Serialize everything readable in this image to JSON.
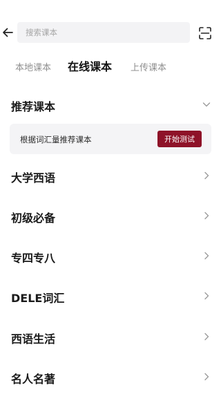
{
  "header": {
    "back_icon": "arrow-left-icon",
    "search_placeholder": "搜索课本",
    "search_value": "",
    "scan_icon": "scan-icon"
  },
  "tabs": [
    {
      "label": "本地课本",
      "active": false
    },
    {
      "label": "在线课本",
      "active": true
    },
    {
      "label": "上传课本",
      "active": false
    }
  ],
  "recommend": {
    "title": "推荐课本",
    "expanded": true,
    "hint": "根据词汇量推荐课本",
    "button_label": "开始测试"
  },
  "categories": [
    {
      "label": "大学西语"
    },
    {
      "label": "初级必备"
    },
    {
      "label": "专四专八"
    },
    {
      "label": "DELE词汇"
    },
    {
      "label": "西语生活"
    },
    {
      "label": "名人名著"
    }
  ],
  "colors": {
    "accent": "#8e1228",
    "card_bg": "#f4f4f6",
    "search_bg": "#f3f3f5",
    "inactive_tab": "#8f8f8f"
  }
}
